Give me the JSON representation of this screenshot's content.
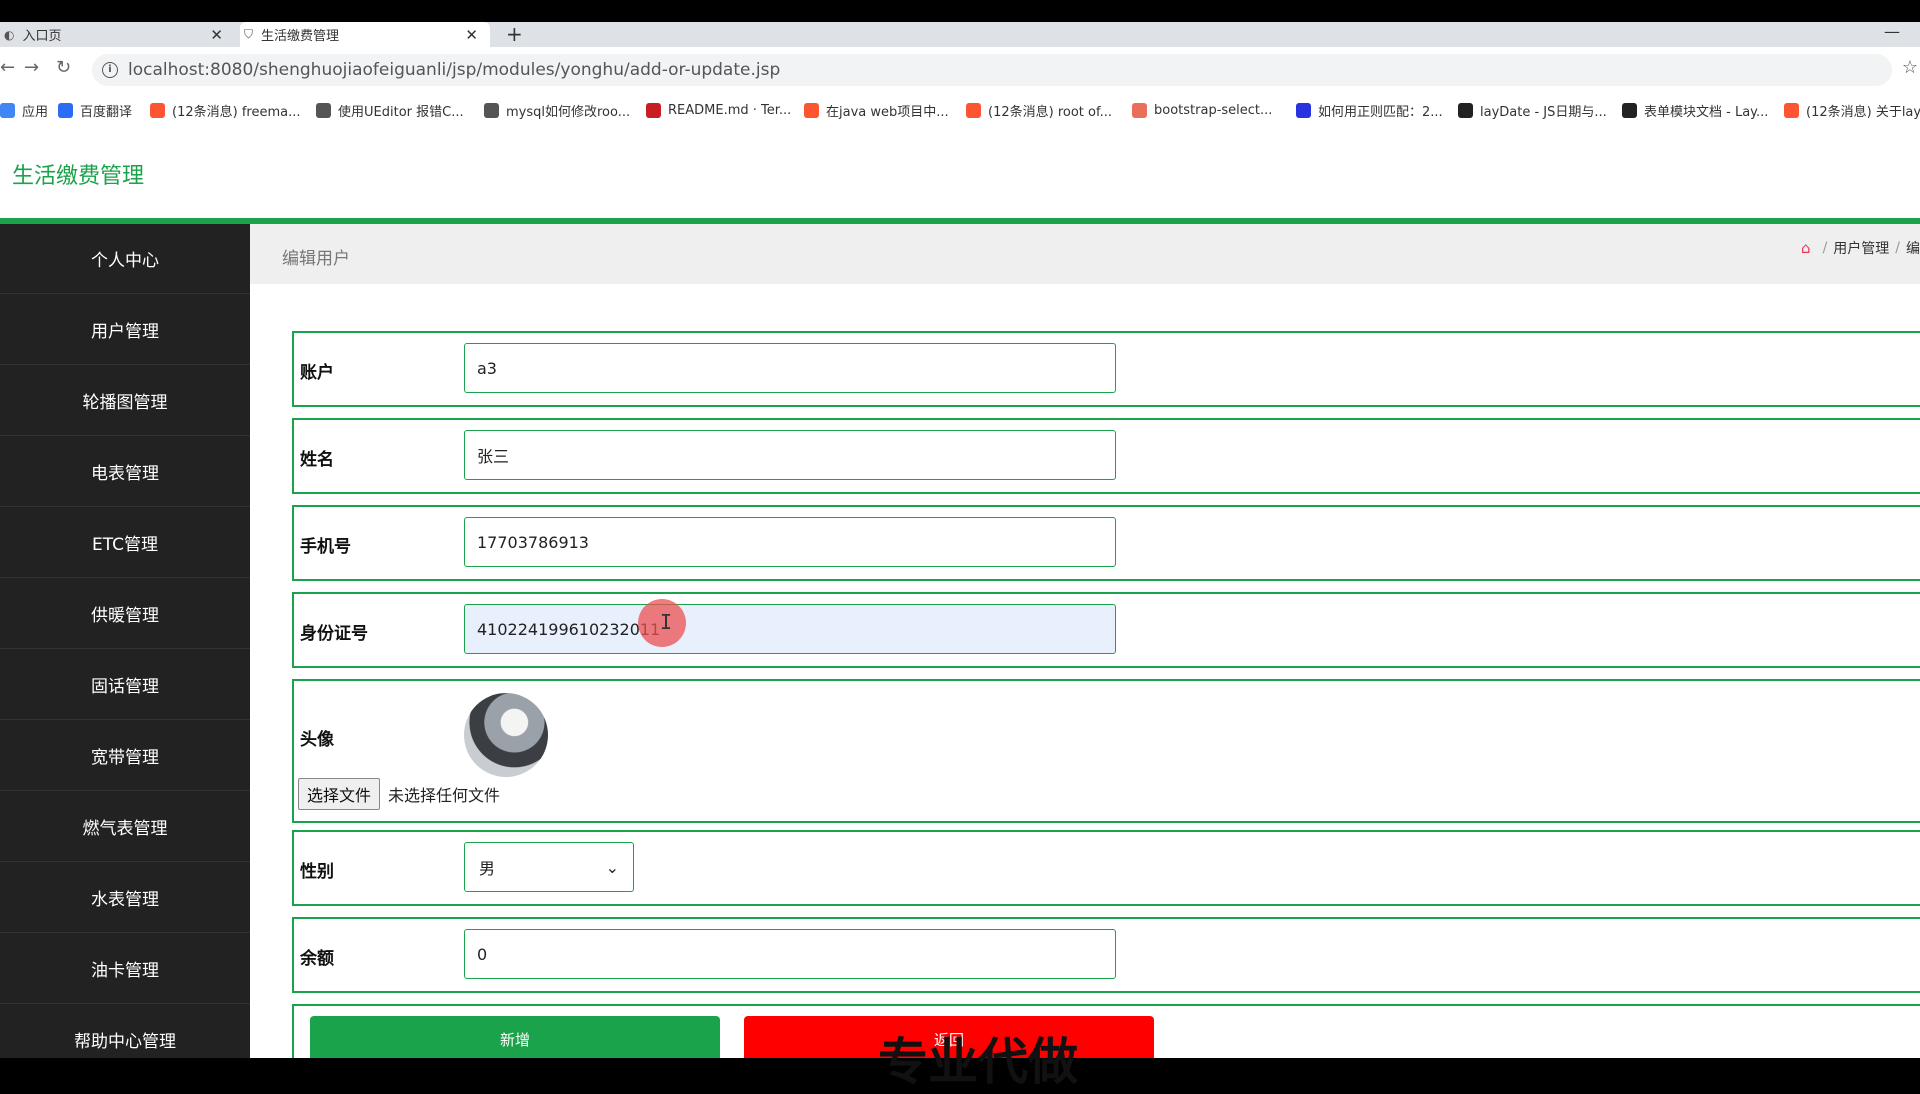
{
  "browser": {
    "tabs": [
      {
        "title": "入口页",
        "active": false
      },
      {
        "title": "生活缴费管理",
        "active": true
      }
    ],
    "new_tab": "+",
    "minimize": "—",
    "url": "localhost:8080/shenghuojiaofeiguanli/jsp/modules/yonghu/add-or-update.jsp",
    "bookmarks": [
      {
        "label": "应用",
        "icon": "apps-icon",
        "color": "#4285f4"
      },
      {
        "label": "百度翻译",
        "icon": "baidu-translate-icon",
        "color": "#2a6df4"
      },
      {
        "label": "(12条消息) freema...",
        "icon": "csdn-icon",
        "color": "#fc5531"
      },
      {
        "label": "使用UEditor 报错C...",
        "icon": "link-icon",
        "color": "#555555"
      },
      {
        "label": "mysql如何修改roo...",
        "icon": "link-icon",
        "color": "#555555"
      },
      {
        "label": "README.md · Ter...",
        "icon": "gitee-icon",
        "color": "#c71d23"
      },
      {
        "label": "在java web项目中...",
        "icon": "csdn-icon",
        "color": "#fc5531"
      },
      {
        "label": "(12条消息) root of...",
        "icon": "csdn-icon",
        "color": "#fc5531"
      },
      {
        "label": "bootstrap-select...",
        "icon": "jianshu-icon",
        "color": "#ea6f5a"
      },
      {
        "label": "如何用正则匹配：2...",
        "icon": "baidu-icon",
        "color": "#2932e1"
      },
      {
        "label": "layDate - JS日期与...",
        "icon": "layui-icon",
        "color": "#222222"
      },
      {
        "label": "表单模块文档 - Lay...",
        "icon": "layui-icon",
        "color": "#222222"
      },
      {
        "label": "(12条消息) 关于lay",
        "icon": "csdn-icon",
        "color": "#fc5531"
      }
    ]
  },
  "app": {
    "title": "生活缴费管理",
    "accent": "#1aa34a"
  },
  "sidebar": {
    "items": [
      {
        "label": "个人中心"
      },
      {
        "label": "用户管理"
      },
      {
        "label": "轮播图管理"
      },
      {
        "label": "电表管理"
      },
      {
        "label": "ETC管理"
      },
      {
        "label": "供暖管理"
      },
      {
        "label": "固话管理"
      },
      {
        "label": "宽带管理"
      },
      {
        "label": "燃气表管理"
      },
      {
        "label": "水表管理"
      },
      {
        "label": "油卡管理"
      },
      {
        "label": "帮助中心管理"
      }
    ]
  },
  "main": {
    "page_title": "编辑用户",
    "breadcrumb": [
      "用户管理",
      "编"
    ],
    "breadcrumb_sep": "/"
  },
  "form": {
    "account": {
      "label": "账户",
      "value": "a3"
    },
    "name": {
      "label": "姓名",
      "value": "张三"
    },
    "phone": {
      "label": "手机号",
      "value": "17703786913"
    },
    "id_number": {
      "label": "身份证号",
      "value": "410224199610232011"
    },
    "avatar": {
      "label": "头像",
      "file_button": "选择文件",
      "file_status": "未选择任何文件"
    },
    "gender": {
      "label": "性别",
      "selected": "男"
    },
    "balance": {
      "label": "余额",
      "value": "0"
    },
    "add_button": "新增",
    "back_button": "返回"
  },
  "overlay_text": "专业代做"
}
